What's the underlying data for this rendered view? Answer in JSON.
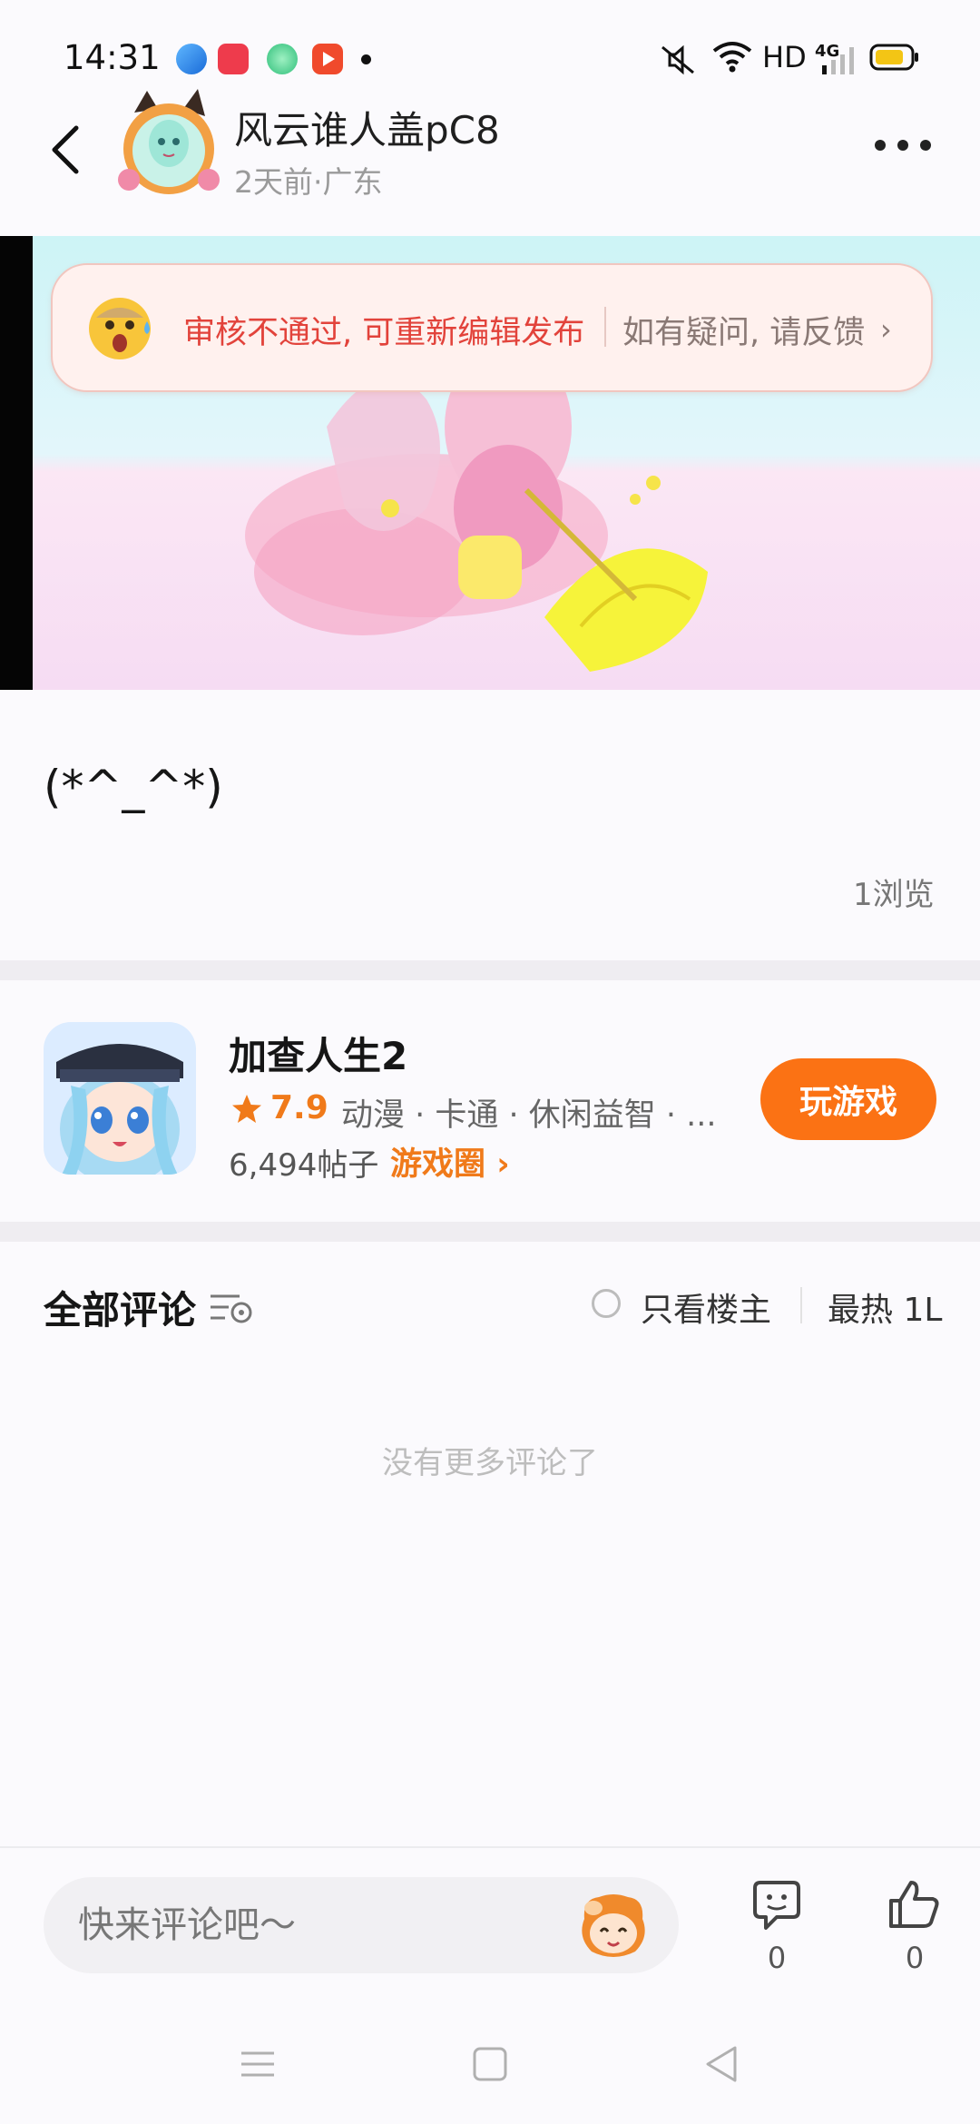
{
  "status_bar": {
    "time": "14:31",
    "network": "HD",
    "network_type": "4G",
    "icons": [
      "messenger-app-icon",
      "red-app-icon",
      "green-app-icon",
      "video-app-icon",
      "mute-icon",
      "wifi-icon",
      "signal-icon",
      "battery-icon"
    ]
  },
  "header": {
    "user_name": "风云谁人盖pC8",
    "post_meta": "2天前·广东",
    "icons": [
      "back-arrow-icon",
      "more-dots-icon"
    ]
  },
  "review_notice": {
    "status_text": "审核不通过, 可重新编辑发布",
    "help_text": "如有疑问, 请反馈",
    "chevron": "›"
  },
  "post": {
    "text": "(*^_^*)",
    "views": "1浏览"
  },
  "game_card": {
    "title": "加查人生2",
    "rating": "7.9",
    "tags": "动漫 · 卡通 · 休闲益智 · ...",
    "post_count": "6,494帖子",
    "circle_link": "游戏圈",
    "circle_chevron": "›",
    "play_button": "玩游戏"
  },
  "comments": {
    "title": "全部评论",
    "only_host": "只看楼主",
    "sort": "最热 1L",
    "empty_text": "没有更多评论了"
  },
  "bottom_bar": {
    "input_placeholder": "快来评论吧～",
    "comment_count": "0",
    "like_count": "0"
  },
  "colors": {
    "accent_orange": "#fb7214",
    "warning_red": "#e2433b"
  }
}
